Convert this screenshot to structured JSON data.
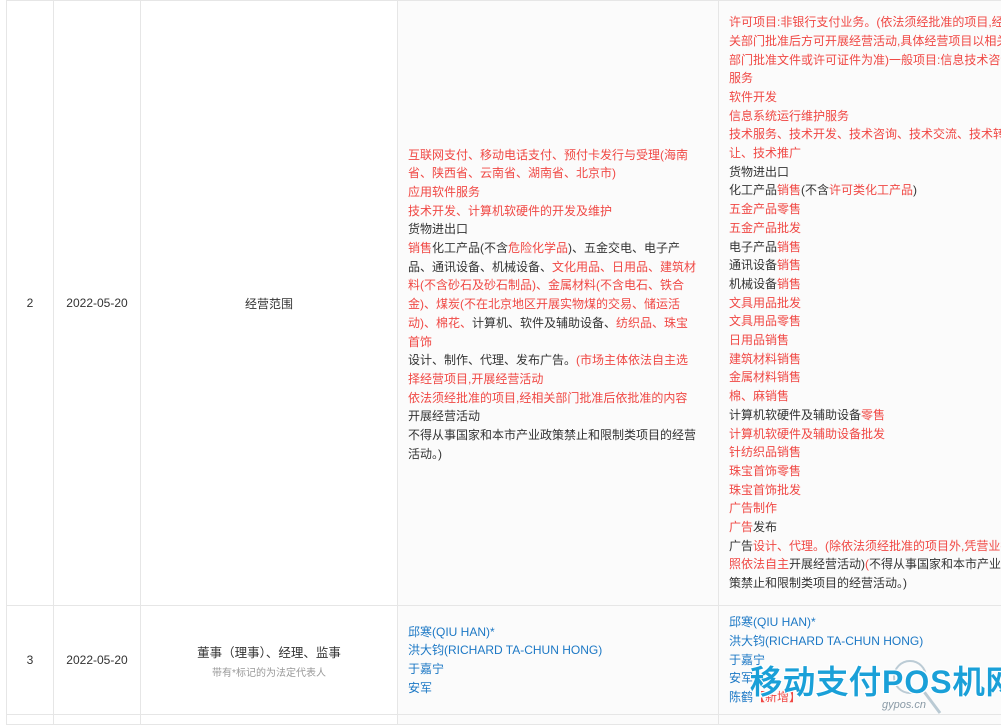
{
  "rows": [
    {
      "no": "2",
      "date": "2022-05-20",
      "item": "经营范围",
      "before": [
        [
          {
            "t": "互联网支付、移动电话支付、预付卡发行与受理(海南",
            "c": "red"
          }
        ],
        [
          {
            "t": "省、陕西省、云南省、湖南省、北京市)",
            "c": "red"
          }
        ],
        [
          {
            "t": "应用软件服务",
            "c": "red"
          }
        ],
        [
          {
            "t": "技术开发、计算机软硬件的开发及维护",
            "c": "red"
          }
        ],
        [
          {
            "t": "货物进出口",
            "c": "blk"
          }
        ],
        [
          {
            "t": "销售",
            "c": "red"
          },
          {
            "t": "化工产品(不含",
            "c": "blk"
          },
          {
            "t": "危险化学品",
            "c": "red"
          },
          {
            "t": ")、五金交电、电子产",
            "c": "blk"
          }
        ],
        [
          {
            "t": "品、通讯设备、机械设备、",
            "c": "blk"
          },
          {
            "t": "文化用品、日用品、建筑材",
            "c": "red"
          }
        ],
        [
          {
            "t": "料(不含砂石及砂石制品)、金属材料(不含电石、铁合",
            "c": "red"
          }
        ],
        [
          {
            "t": "金)、煤炭(不在北京地区开展实物煤的交易、储运活",
            "c": "red"
          }
        ],
        [
          {
            "t": "动)、棉花、",
            "c": "red"
          },
          {
            "t": "计算机、软件及辅助设备、",
            "c": "blk"
          },
          {
            "t": "纺织品、珠宝",
            "c": "red"
          }
        ],
        [
          {
            "t": "首饰",
            "c": "red"
          }
        ],
        [
          {
            "t": "设计、制作、代理、发布广告。",
            "c": "blk"
          },
          {
            "t": "(市场主体依法自主选",
            "c": "red"
          }
        ],
        [
          {
            "t": "择经营项目,开展经营活动",
            "c": "red"
          }
        ],
        [
          {
            "t": "依法须经批准的项目,经相关部门批准后依批准的内容",
            "c": "red"
          }
        ],
        [
          {
            "t": "开展经营活动",
            "c": "blk"
          }
        ],
        [
          {
            "t": "不得从事国家和本市产业政策禁止和限制类项目的经营",
            "c": "blk"
          }
        ],
        [
          {
            "t": "活动。)",
            "c": "blk"
          }
        ]
      ],
      "after": [
        [
          {
            "t": "许可项目:非银行支付业务。(依法须经批准的项目,经相",
            "c": "red"
          }
        ],
        [
          {
            "t": "关部门批准后方可开展经营活动,具体经营项目以相关",
            "c": "red"
          }
        ],
        [
          {
            "t": "部门批准文件或许可证件为准)一般项目:信息技术咨询",
            "c": "red"
          }
        ],
        [
          {
            "t": "服务",
            "c": "red"
          }
        ],
        [
          {
            "t": "软件开发",
            "c": "red"
          }
        ],
        [
          {
            "t": "信息系统运行维护服务",
            "c": "red"
          }
        ],
        [
          {
            "t": "技术服务、技术开发、技术咨询、技术交流、技术转",
            "c": "red"
          }
        ],
        [
          {
            "t": "让、技术推广",
            "c": "red"
          }
        ],
        [
          {
            "t": "货物进出口",
            "c": "blk"
          }
        ],
        [
          {
            "t": "化工产品",
            "c": "blk"
          },
          {
            "t": "销售",
            "c": "red"
          },
          {
            "t": "(不含",
            "c": "blk"
          },
          {
            "t": "许可类化工产品",
            "c": "red"
          },
          {
            "t": ")",
            "c": "blk"
          }
        ],
        [
          {
            "t": "五金产品零售",
            "c": "red"
          }
        ],
        [
          {
            "t": "五金产品批发",
            "c": "red"
          }
        ],
        [
          {
            "t": "电子产品",
            "c": "blk"
          },
          {
            "t": "销售",
            "c": "red"
          }
        ],
        [
          {
            "t": "通讯设备",
            "c": "blk"
          },
          {
            "t": "销售",
            "c": "red"
          }
        ],
        [
          {
            "t": "机械设备",
            "c": "blk"
          },
          {
            "t": "销售",
            "c": "red"
          }
        ],
        [
          {
            "t": "文具用品批发",
            "c": "red"
          }
        ],
        [
          {
            "t": "文具用品零售",
            "c": "red"
          }
        ],
        [
          {
            "t": "日用品销售",
            "c": "red"
          }
        ],
        [
          {
            "t": "建筑材料销售",
            "c": "red"
          }
        ],
        [
          {
            "t": "金属材料销售",
            "c": "red"
          }
        ],
        [
          {
            "t": "棉、麻销售",
            "c": "red"
          }
        ],
        [
          {
            "t": "计算机软硬件及辅助设备",
            "c": "blk"
          },
          {
            "t": "零售",
            "c": "red"
          }
        ],
        [
          {
            "t": "计算机软硬件及辅助设备批发",
            "c": "red"
          }
        ],
        [
          {
            "t": "针纺织品销售",
            "c": "red"
          }
        ],
        [
          {
            "t": "珠宝首饰零售",
            "c": "red"
          }
        ],
        [
          {
            "t": "珠宝首饰批发",
            "c": "red"
          }
        ],
        [
          {
            "t": "广告制作",
            "c": "red"
          }
        ],
        [
          {
            "t": "广告",
            "c": "red"
          },
          {
            "t": "发布",
            "c": "blk"
          }
        ],
        [
          {
            "t": "广告",
            "c": "blk"
          },
          {
            "t": "设计、代理。(除依法须经批准的项目外,凭营业执",
            "c": "red"
          }
        ],
        [
          {
            "t": "照依法自主",
            "c": "red"
          },
          {
            "t": "开展经营活动)",
            "c": "blk"
          },
          {
            "t": "(",
            "c": "red"
          },
          {
            "t": "不得从事国家和本市产业政",
            "c": "blk"
          }
        ],
        [
          {
            "t": "策禁止和限制类项目的经营活动。)",
            "c": "blk"
          }
        ]
      ]
    },
    {
      "no": "3",
      "date": "2022-05-20",
      "item": "董事（理事）、经理、监事",
      "item_note": "带有*标记的为法定代表人",
      "before": [
        [
          {
            "t": "邱寒(QIU HAN)*",
            "c": "blue"
          }
        ],
        [
          {
            "t": "洪大钧(RICHARD TA-CHUN HONG)",
            "c": "blue"
          }
        ],
        [
          {
            "t": "于嘉宁",
            "c": "blue"
          }
        ],
        [
          {
            "t": "安军",
            "c": "blue"
          }
        ]
      ],
      "after": [
        [
          {
            "t": "邱寒(QIU HAN)*",
            "c": "blue"
          }
        ],
        [
          {
            "t": "洪大钧(RICHARD TA-CHUN HONG)",
            "c": "blue"
          }
        ],
        [
          {
            "t": "于嘉宁",
            "c": "blue"
          }
        ],
        [
          {
            "t": "安军",
            "c": "blue"
          }
        ],
        [
          {
            "t": "陈鹤",
            "c": "blue"
          },
          {
            "t": "【新增】",
            "c": "tag"
          }
        ]
      ]
    }
  ],
  "watermark": {
    "text": "移动支付POS机网",
    "url": "gypos.cn",
    "icon": "magnifier-icon",
    "color": "#1aa0d8"
  }
}
